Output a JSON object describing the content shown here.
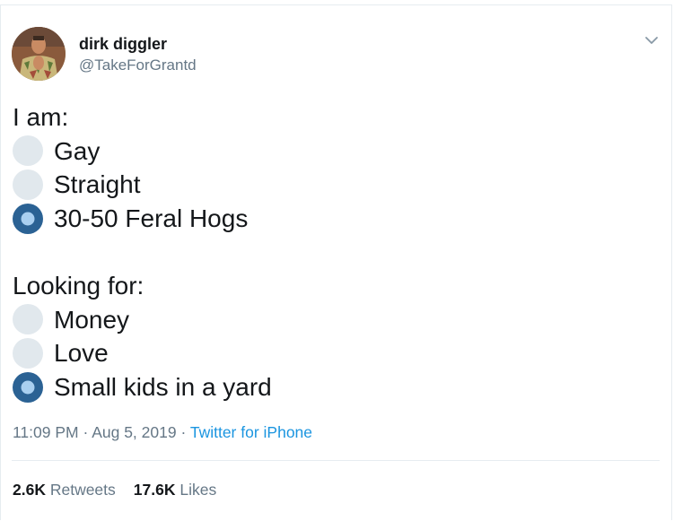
{
  "user": {
    "display_name": "dirk diggler",
    "handle": "@TakeForGrantd",
    "avatar_icon": "profile-photo"
  },
  "menu_icon": "chevron-down-icon",
  "tweet": {
    "section1_heading": "I am:",
    "section1_options": [
      {
        "label": "Gay",
        "selected": false
      },
      {
        "label": "Straight",
        "selected": false
      },
      {
        "label": "30-50 Feral Hogs",
        "selected": true
      }
    ],
    "section2_heading": "Looking for:",
    "section2_options": [
      {
        "label": "Money",
        "selected": false
      },
      {
        "label": "Love",
        "selected": false
      },
      {
        "label": "Small kids in a yard",
        "selected": true
      }
    ]
  },
  "meta": {
    "time": "11:09 PM",
    "separator": " · ",
    "date": "Aug 5, 2019",
    "source": "Twitter for iPhone"
  },
  "stats": {
    "retweets_count": "2.6K",
    "retweets_label": " Retweets",
    "likes_count": "17.6K",
    "likes_label": " Likes"
  },
  "colors": {
    "radio_unselected": "#e1e8ed",
    "radio_selected": "#2b6294",
    "radio_selected_dot": "#a9cff0",
    "link": "#1b95e0",
    "muted": "#657786",
    "text": "#14171a"
  }
}
